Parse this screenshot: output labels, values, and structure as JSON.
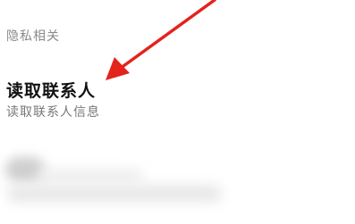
{
  "section": {
    "header": "隐私相关"
  },
  "item": {
    "title": "读取联系人",
    "subtitle": "读取联系人信息"
  },
  "annotation": {
    "arrow_color": "#e3231c"
  }
}
